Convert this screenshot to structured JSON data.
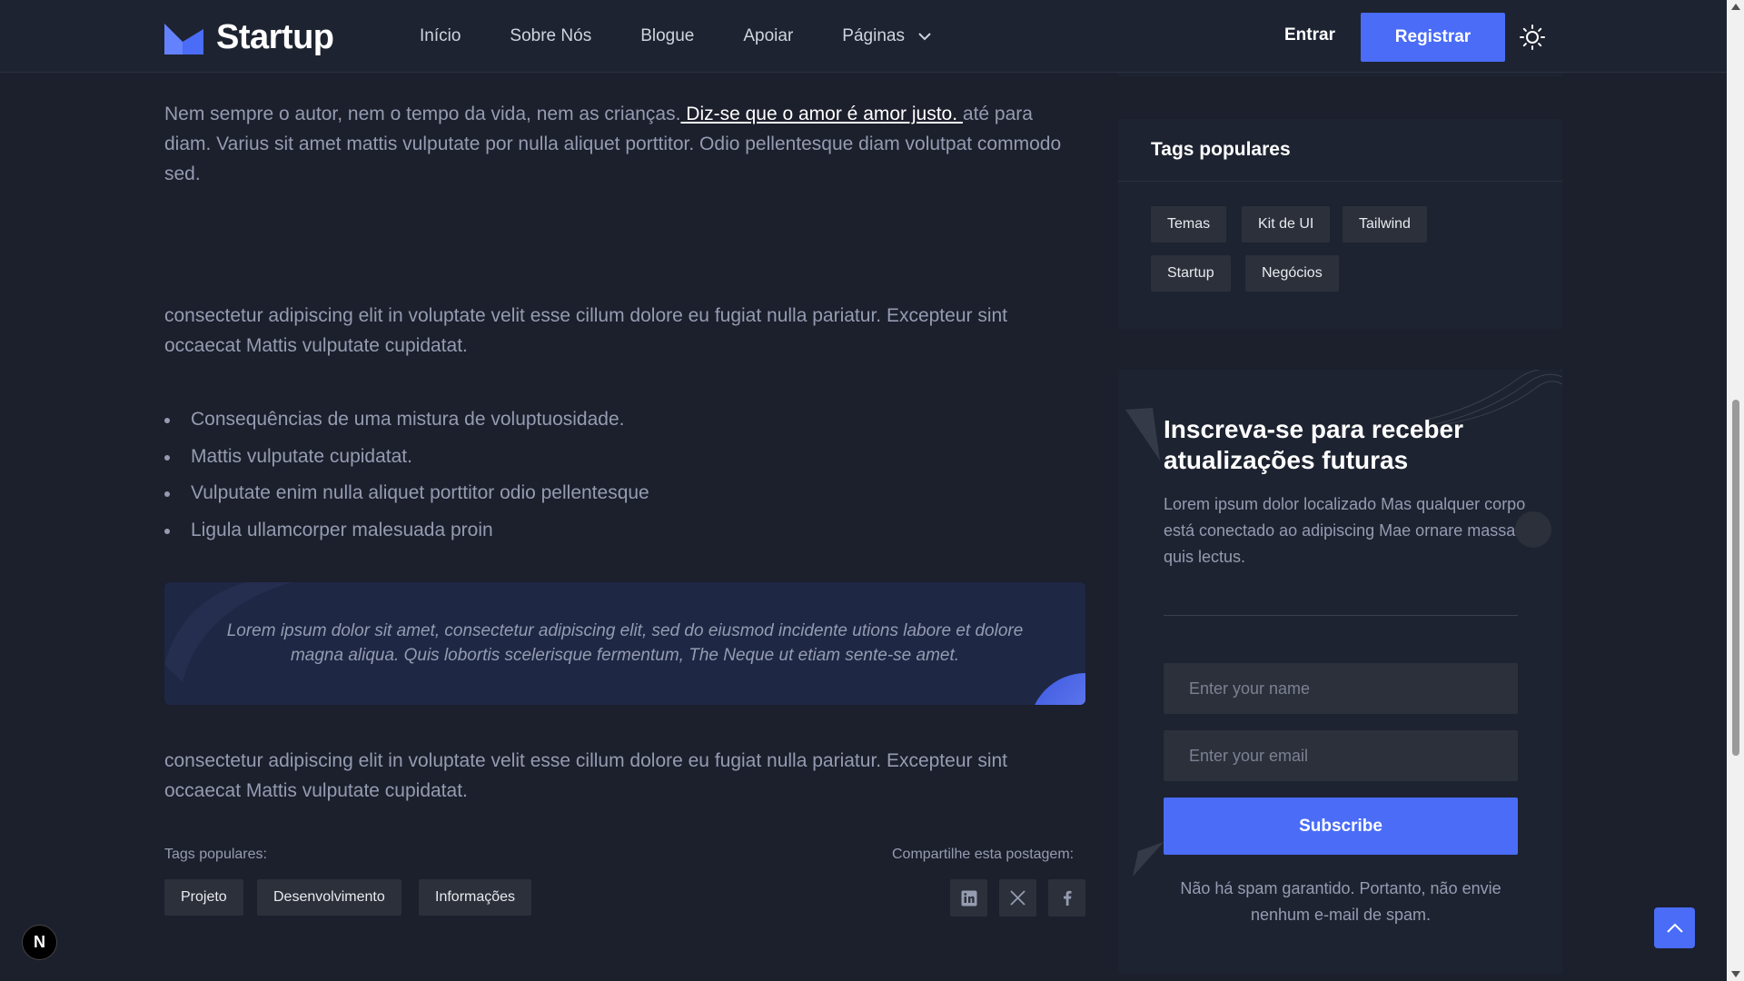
{
  "header": {
    "logo_text": "Startup",
    "nav": [
      {
        "label": "Início"
      },
      {
        "label": "Sobre Nós"
      },
      {
        "label": "Blogue"
      },
      {
        "label": "Apoiar"
      },
      {
        "label": "Páginas"
      }
    ],
    "signin_label": "Entrar",
    "signup_label": "Registrar"
  },
  "article": {
    "para1_text": "Nem sempre o autor, nem o tempo da vida, nem as crianças.",
    "para1_link": " Diz-se que o amor é amor justo. ",
    "para1_rest": "até para diam. Varius sit amet mattis vulputate por nulla aliquet porttitor. Odio pellentesque diam volutpat commodo sed.",
    "para2": "consectetur adipiscing elit in voluptate velit esse cillum dolore eu fugiat nulla pariatur. Excepteur sint occaecat Mattis vulputate cupidatat.",
    "bullets": [
      "Consequências de uma mistura de voluptuosidade.",
      "Mattis vulputate cupidatat.",
      "Vulputate enim nulla aliquet porttitor odio pellentesque",
      "Ligula ullamcorper malesuada proin"
    ],
    "quote": "Lorem ipsum dolor sit amet, consectetur adipiscing elit, sed do eiusmod incidente utions labore et dolore magna aliqua. Quis lobortis scelerisque fermentum, The Neque ut etiam sente-se amet.",
    "para3": "consectetur adipiscing elit in voluptate velit esse cillum dolore eu fugiat nulla pariatur. Excepteur sint occaecat Mattis vulputate cupidatat.",
    "tags_label": "Tags populares:",
    "tags": [
      "Projeto",
      "Desenvolvimento",
      "Informações"
    ],
    "share_label": "Compartilhe esta postagem:"
  },
  "sidebar": {
    "tags_title": "Tags populares",
    "tags": [
      "Temas",
      "Kit de UI",
      "Tailwind",
      "Startup",
      "Negócios"
    ],
    "newsletter": {
      "title": "Inscreva-se para receber atualizações futuras",
      "description": "Lorem ipsum dolor localizado Mas qualquer corpo está conectado ao adipiscing Mae ornare massa quis lectus.",
      "name_placeholder": "Enter your name",
      "email_placeholder": "Enter your email",
      "button_label": "Subscribe",
      "note": "Não há spam garantido. Portanto, não envie nenhum e-mail de spam."
    }
  },
  "misc": {
    "badge_letter": "N"
  },
  "colors": {
    "primary": "#4a6cf7",
    "background": "#1c1f2c",
    "card": "#1e2331",
    "tag_bg": "#2c303b"
  }
}
